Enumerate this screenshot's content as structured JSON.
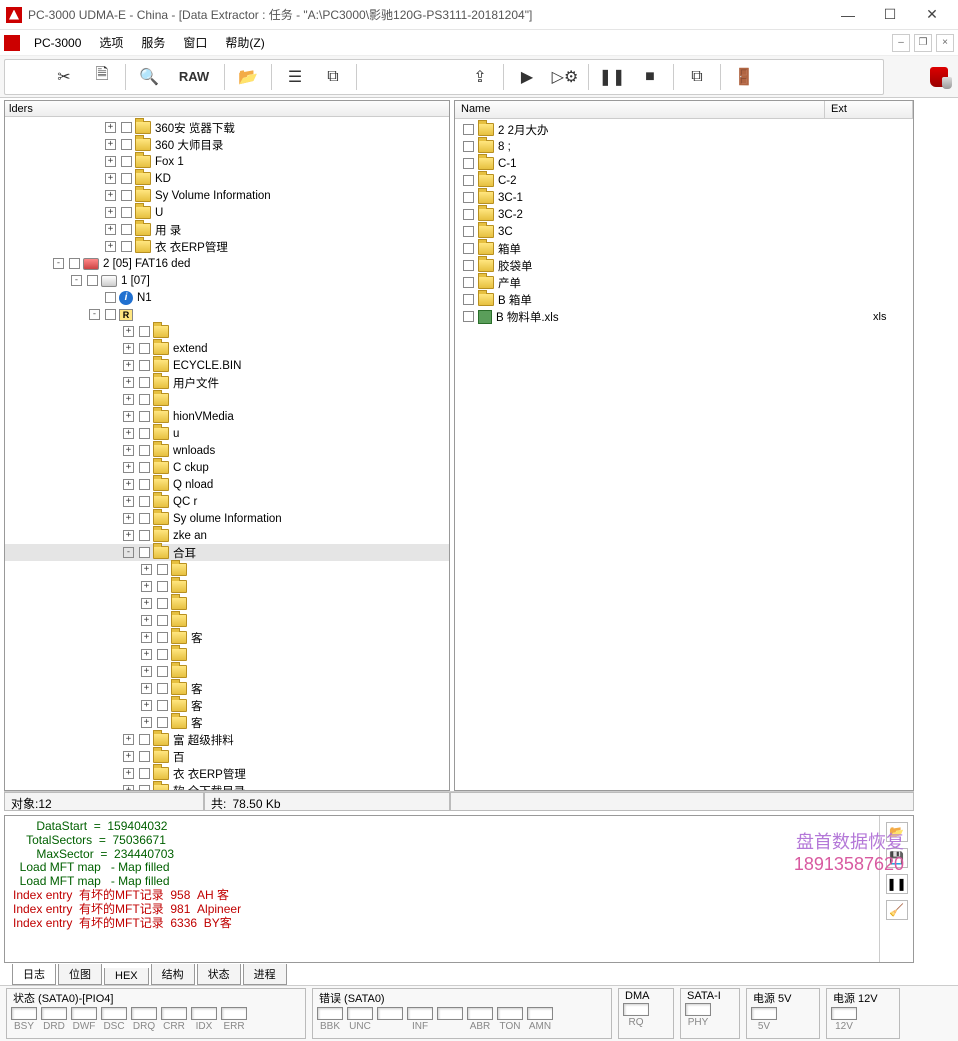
{
  "title": "PC-3000 UDMA-E - China - [Data Extractor : 任务 - \"A:\\PC3000\\影驰120G-PS3111-20181204\"]",
  "menu": {
    "brand": "PC-3000",
    "items": [
      "选项",
      "服务",
      "窗口",
      "帮助(Z)"
    ]
  },
  "toolbar": {
    "raw": "RAW"
  },
  "left_header": "lders",
  "tree": [
    {
      "d": 100,
      "exp": "+",
      "icon": "fld",
      "label": "360安    览器下载"
    },
    {
      "d": 100,
      "exp": "+",
      "icon": "fld",
      "label": "360     大师目录"
    },
    {
      "d": 100,
      "exp": "+",
      "icon": "fld",
      "label": "Fox    1"
    },
    {
      "d": 100,
      "exp": "+",
      "icon": "fld",
      "label": "KD"
    },
    {
      "d": 100,
      "exp": "+",
      "icon": "fld",
      "label": "Sy     Volume Information"
    },
    {
      "d": 100,
      "exp": "+",
      "icon": "fld",
      "label": "U"
    },
    {
      "d": 100,
      "exp": "+",
      "icon": "fld",
      "label": "用    录"
    },
    {
      "d": 100,
      "exp": "+",
      "icon": "fld",
      "label": "衣     衣ERP管理"
    },
    {
      "d": 48,
      "exp": "-",
      "icon": "drv",
      "label": "2 [05] FAT16    ded",
      "red": true
    },
    {
      "d": 66,
      "exp": "-",
      "icon": "drv",
      "label": "1 [07]"
    },
    {
      "d": 84,
      "exp": "",
      "icon": "info",
      "label": "N1"
    },
    {
      "d": 84,
      "exp": "-",
      "icon": "rbox",
      "label": ""
    },
    {
      "d": 118,
      "exp": "+",
      "icon": "fld",
      "label": ""
    },
    {
      "d": 118,
      "exp": "+",
      "icon": "fld",
      "label": "extend"
    },
    {
      "d": 118,
      "exp": "+",
      "icon": "fld",
      "label": "ECYCLE.BIN"
    },
    {
      "d": 118,
      "exp": "+",
      "icon": "fld",
      "label": "用户文件"
    },
    {
      "d": 118,
      "exp": "+",
      "icon": "fld",
      "label": ""
    },
    {
      "d": 118,
      "exp": "+",
      "icon": "fld",
      "label": "hionVMedia"
    },
    {
      "d": 118,
      "exp": "+",
      "icon": "fld",
      "label": "u"
    },
    {
      "d": 118,
      "exp": "+",
      "icon": "fld",
      "label": "wnloads"
    },
    {
      "d": 118,
      "exp": "+",
      "icon": "fld",
      "label": "C     ckup"
    },
    {
      "d": 118,
      "exp": "+",
      "icon": "fld",
      "label": "Q     nload"
    },
    {
      "d": 118,
      "exp": "+",
      "icon": "fld",
      "label": "QC    r"
    },
    {
      "d": 118,
      "exp": "+",
      "icon": "fld",
      "label": "Sy     olume Information"
    },
    {
      "d": 118,
      "exp": "+",
      "icon": "fld",
      "label": "zke    an"
    },
    {
      "d": 118,
      "exp": "-",
      "icon": "fld",
      "label": "合耳",
      "sel": true
    },
    {
      "d": 136,
      "exp": "+",
      "icon": "fld",
      "label": ""
    },
    {
      "d": 136,
      "exp": "+",
      "icon": "fld",
      "label": ""
    },
    {
      "d": 136,
      "exp": "+",
      "icon": "fld",
      "label": ""
    },
    {
      "d": 136,
      "exp": "+",
      "icon": "fld",
      "label": ""
    },
    {
      "d": 136,
      "exp": "+",
      "icon": "fld",
      "label": "客"
    },
    {
      "d": 136,
      "exp": "+",
      "icon": "fld",
      "label": ""
    },
    {
      "d": 136,
      "exp": "+",
      "icon": "fld",
      "label": ""
    },
    {
      "d": 136,
      "exp": "+",
      "icon": "fld",
      "label": "客"
    },
    {
      "d": 136,
      "exp": "+",
      "icon": "fld",
      "label": "     客"
    },
    {
      "d": 136,
      "exp": "+",
      "icon": "fld",
      "label": "     客"
    },
    {
      "d": 118,
      "exp": "+",
      "icon": "fld",
      "label": "富    超级排料"
    },
    {
      "d": 118,
      "exp": "+",
      "icon": "fld",
      "label": "百"
    },
    {
      "d": 118,
      "exp": "+",
      "icon": "fld",
      "label": "衣    衣ERP管理"
    },
    {
      "d": 118,
      "exp": "+",
      "icon": "fld",
      "label": "软    全下载目录"
    }
  ],
  "right_cols": {
    "name": "Name",
    "ext": "Ext"
  },
  "files": [
    {
      "icon": "fld",
      "name": "2      2月大办",
      "ext": ""
    },
    {
      "icon": "fld",
      "name": "8      ;",
      "ext": ""
    },
    {
      "icon": "fld",
      "name": "       C-1",
      "ext": ""
    },
    {
      "icon": "fld",
      "name": "       C-2",
      "ext": ""
    },
    {
      "icon": "fld",
      "name": "       3C-1",
      "ext": ""
    },
    {
      "icon": "fld",
      "name": "       3C-2",
      "ext": ""
    },
    {
      "icon": "fld",
      "name": "       3C",
      "ext": ""
    },
    {
      "icon": "fld",
      "name": "      箱单",
      "ext": ""
    },
    {
      "icon": "fld",
      "name": "      胶袋单",
      "ext": ""
    },
    {
      "icon": "fld",
      "name": "      产单",
      "ext": ""
    },
    {
      "icon": "fld",
      "name": "B      箱单",
      "ext": ""
    },
    {
      "icon": "xls",
      "name": "B      物料单.xls",
      "ext": "xls"
    }
  ],
  "status": {
    "objects_label": "对象:",
    "objects_value": "12",
    "total_label": "共:",
    "total_value": "78.50 Kb"
  },
  "log_lines": [
    {
      "cls": "grn",
      "text": "       DataStart  =  159404032"
    },
    {
      "cls": "grn",
      "text": "    TotalSectors  =  75036671"
    },
    {
      "cls": "grn",
      "text": "       MaxSector  =  234440703"
    },
    {
      "cls": "grn",
      "text": "  Load MFT map   - Map filled"
    },
    {
      "cls": "grn",
      "text": "  Load MFT map   - Map filled"
    },
    {
      "cls": "red",
      "text": "Index entry  有坏的MFT记录  958  AH 客"
    },
    {
      "cls": "red",
      "text": "Index entry  有坏的MFT记录  981  Alpineer"
    },
    {
      "cls": "red",
      "text": "Index entry  有坏的MFT记录  6336  BY客"
    }
  ],
  "watermark": {
    "line1": "盘首数据恢复",
    "line2": "18913587620"
  },
  "log_tabs": [
    "日志",
    "位图",
    "HEX",
    "结构",
    "状态",
    "进程"
  ],
  "hw": {
    "sata0": {
      "label": "状态 (SATA0)-[PIO4]",
      "leds": [
        "BSY",
        "DRD",
        "DWF",
        "DSC",
        "DRQ",
        "CRR",
        "IDX",
        "ERR"
      ]
    },
    "err": {
      "label": "错误 (SATA0)",
      "leds": [
        "BBK",
        "UNC",
        "",
        "INF",
        "",
        "ABR",
        "TON",
        "AMN"
      ]
    },
    "dma": {
      "label": "DMA",
      "leds": [
        "RQ"
      ]
    },
    "satai": {
      "label": "SATA-I",
      "leds": [
        "PHY"
      ]
    },
    "p5": {
      "label": "电源 5V",
      "leds": [
        "5V"
      ]
    },
    "p12": {
      "label": "电源 12V",
      "leds": [
        "12V"
      ]
    }
  }
}
